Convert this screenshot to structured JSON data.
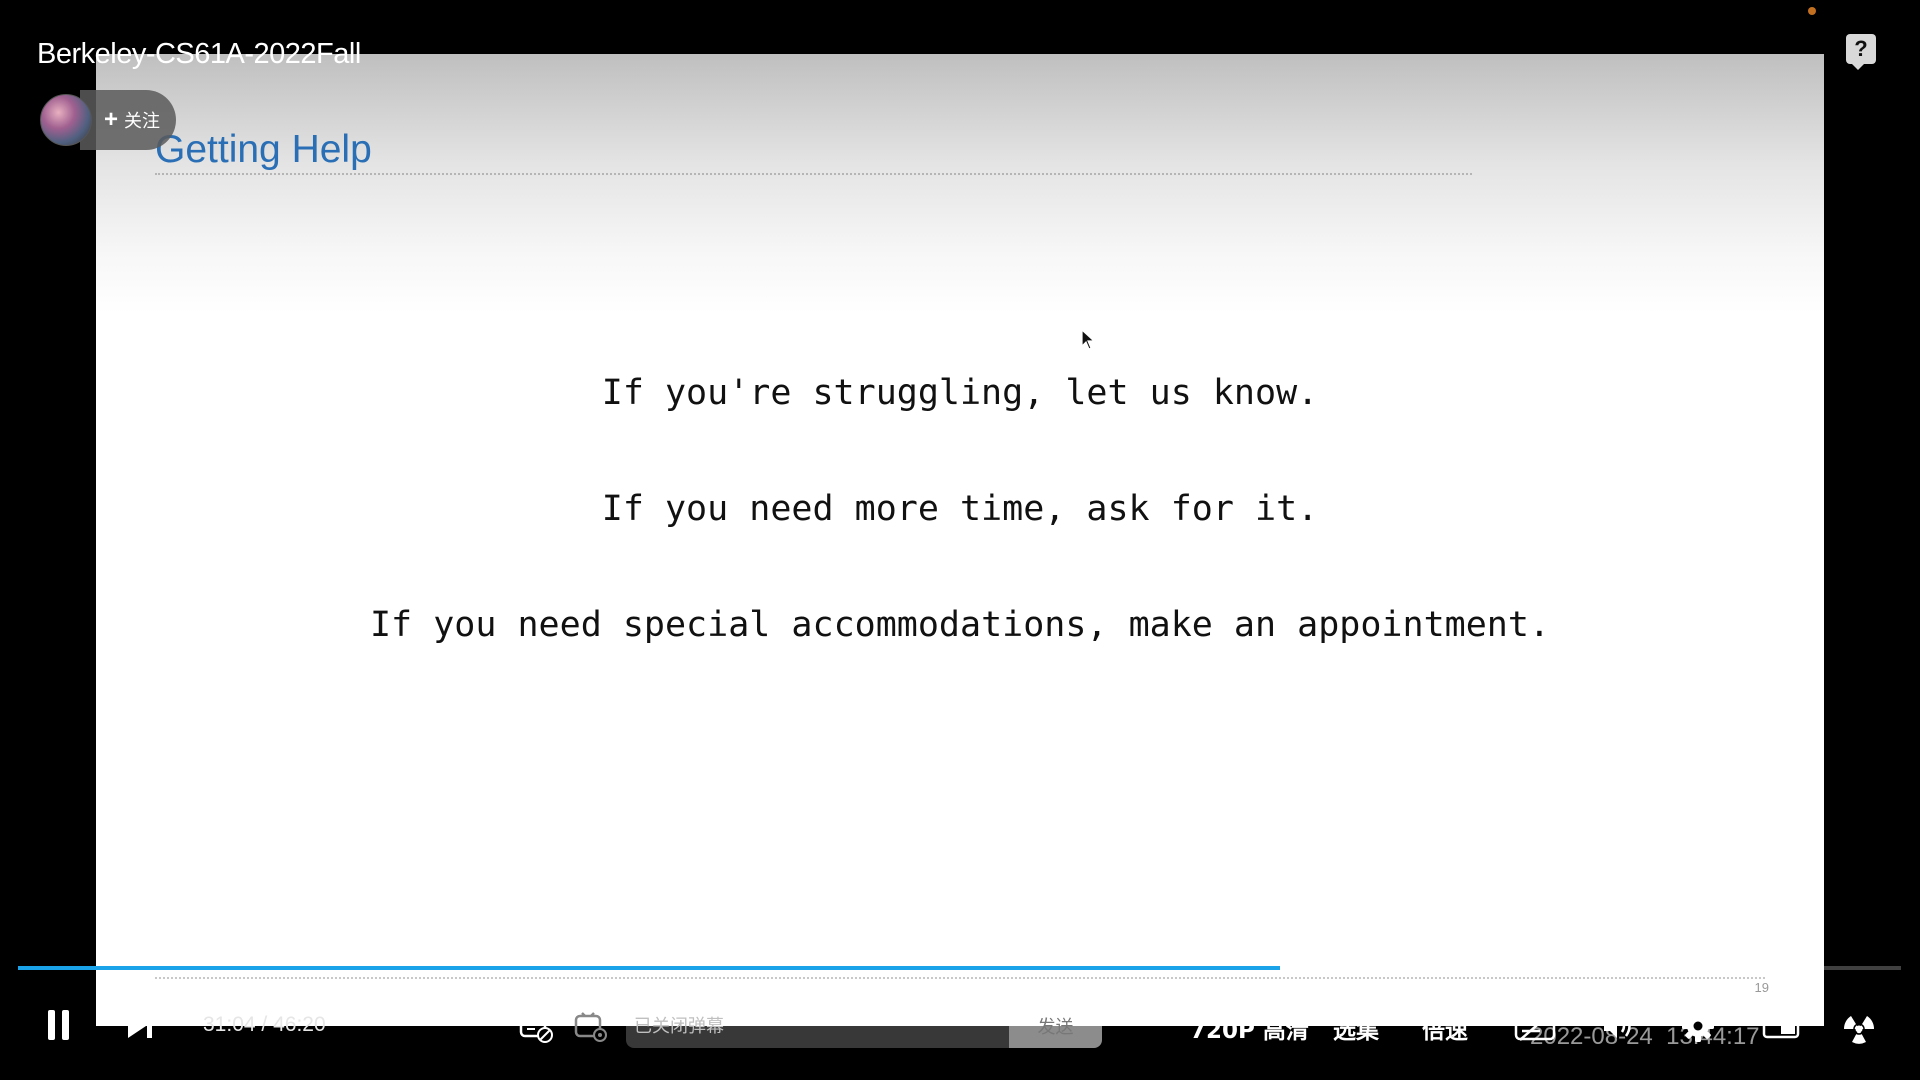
{
  "player": {
    "video_title": "Berkeley-CS61A-2022Fall",
    "follow_label": "关注",
    "help_glyph": "?"
  },
  "slide": {
    "title": "Getting Help",
    "lines": [
      "If you're struggling, let us know.",
      "If you need more time, ask for it.",
      "If you need special accommodations, make an appointment."
    ],
    "page_number": "19"
  },
  "controls": {
    "current_time": "31:04",
    "separator": "/",
    "duration": "46:20",
    "progress": 0.67,
    "danmaku_placeholder": "已关闭弹幕",
    "send_label": "发送",
    "quality_label": "720P 高清",
    "episodes_label": "选集",
    "speed_label": "倍速",
    "timestamp": "2022-08-24  13:44:17"
  },
  "icons": {
    "pause": "pause-icon",
    "next": "next-icon",
    "danmaku_toggle": "danmaku-toggle-icon",
    "danmaku_settings": "danmaku-settings-icon",
    "subtitle": "subtitle-icon",
    "volume": "volume-icon",
    "settings": "gear-icon",
    "pip": "picture-in-picture-icon",
    "fullscreen": "fullscreen-icon",
    "help": "help-icon"
  },
  "colors": {
    "progress": "#1aa3e8",
    "slide_title": "#2a6fb5",
    "recording_dot": "#c2701f"
  }
}
